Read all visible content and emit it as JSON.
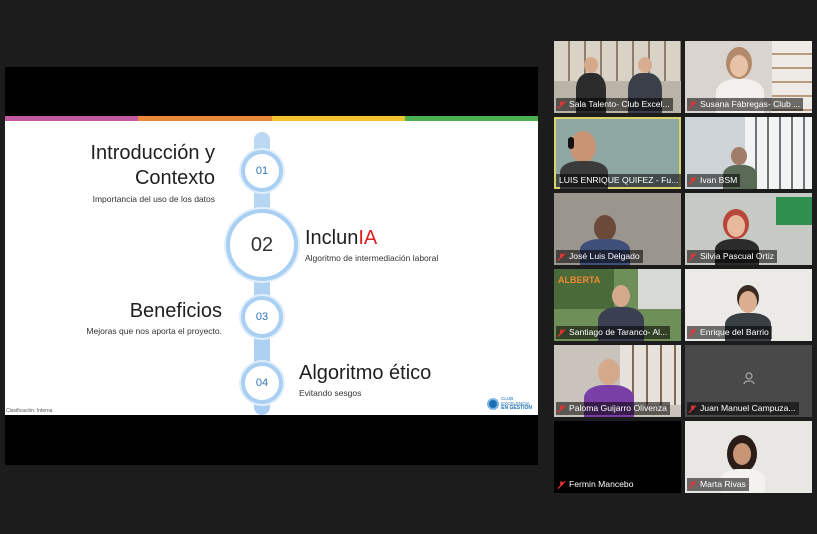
{
  "slide": {
    "items": [
      {
        "number": "01",
        "title_line1": "Introducción y",
        "title_line2": "Contexto",
        "subtitle": "Importancia del uso de los datos"
      },
      {
        "number": "02",
        "title_main": "Inclun",
        "title_accent": "IA",
        "subtitle": "Algoritmo de intermediación laboral"
      },
      {
        "number": "03",
        "title": "Beneficios",
        "subtitle": "Mejoras que nos aporta el proyecto."
      },
      {
        "number": "04",
        "title": "Algoritmo ético",
        "subtitle": "Evitando sesgos"
      }
    ],
    "footer_label": "Clasificación: Interna",
    "logo_lines": [
      "CLUB",
      "EXCELENCIA",
      "EN GESTIÓN"
    ],
    "colors": {
      "bar": [
        "#c25aa0",
        "#e9893a",
        "#f2c230",
        "#4caf50"
      ],
      "spine": "#a9d0f3",
      "accent": "#e02020"
    }
  },
  "participants": [
    {
      "name": "Sala Talento- Club Excel...",
      "muted": true
    },
    {
      "name": "Susana Fábregas- Club ...",
      "muted": true
    },
    {
      "name": "LUIS ENRIQUE QUIFEZ - Fu...",
      "muted": false,
      "active_speaker": true
    },
    {
      "name": "Ivan BSM",
      "muted": true
    },
    {
      "name": "José Luis Delgado",
      "muted": true
    },
    {
      "name": "Silvia Pascual Ortiz",
      "muted": true
    },
    {
      "name": "Santiago de Taranco- Al...",
      "muted": true
    },
    {
      "name": "Enrique del Barrio",
      "muted": true
    },
    {
      "name": "Paloma Guijarro Olivenza",
      "muted": true
    },
    {
      "name": "Juan Manuel Campuza...",
      "muted": true
    },
    {
      "name": "Fermin Mancebo",
      "muted": true
    },
    {
      "name": "Marta Rivas",
      "muted": true
    }
  ],
  "icons": {
    "muted": "mic-muted-icon",
    "no_video": "user-placeholder-icon"
  }
}
